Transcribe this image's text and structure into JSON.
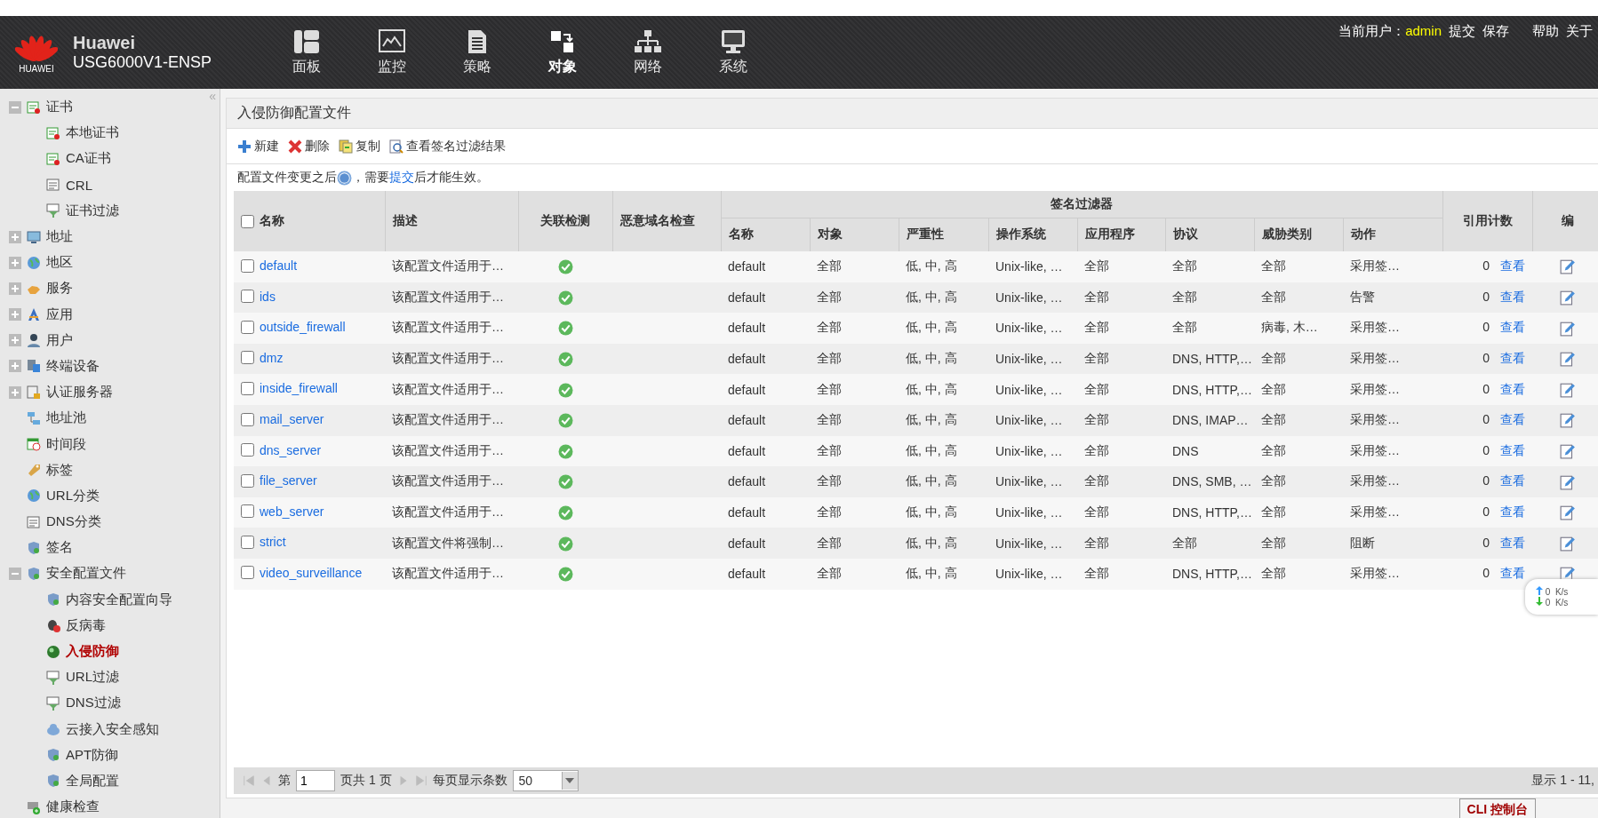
{
  "brand": {
    "name": "Huawei",
    "model": "USG6000V1-ENSP",
    "logo_text": "HUAWEI"
  },
  "nav": [
    {
      "label": "面板",
      "selected": false
    },
    {
      "label": "监控",
      "selected": false
    },
    {
      "label": "策略",
      "selected": false
    },
    {
      "label": "对象",
      "selected": true
    },
    {
      "label": "网络",
      "selected": false
    },
    {
      "label": "系统",
      "selected": false
    }
  ],
  "user_bar": {
    "label": "当前用户：",
    "user": "admin",
    "actions": [
      "提交",
      "保存",
      "帮助",
      "关于"
    ]
  },
  "sidebar": {
    "collapse": "«",
    "items": [
      {
        "label": "证书",
        "expanded": true,
        "selected": false,
        "children": [
          {
            "label": "本地证书",
            "selected": false
          },
          {
            "label": "CA证书",
            "selected": false
          },
          {
            "label": "CRL",
            "selected": false
          },
          {
            "label": "证书过滤",
            "selected": false
          }
        ]
      },
      {
        "label": "地址",
        "expanded": false,
        "selected": false
      },
      {
        "label": "地区",
        "expanded": false,
        "selected": false
      },
      {
        "label": "服务",
        "expanded": false,
        "selected": false
      },
      {
        "label": "应用",
        "expanded": false,
        "selected": false
      },
      {
        "label": "用户",
        "expanded": false,
        "selected": false
      },
      {
        "label": "终端设备",
        "expanded": false,
        "selected": false
      },
      {
        "label": "认证服务器",
        "expanded": false,
        "selected": false
      },
      {
        "label": "地址池",
        "selected": false
      },
      {
        "label": "时间段",
        "selected": false
      },
      {
        "label": "标签",
        "selected": false
      },
      {
        "label": "URL分类",
        "selected": false
      },
      {
        "label": "DNS分类",
        "selected": false
      },
      {
        "label": "签名",
        "selected": false
      },
      {
        "label": "安全配置文件",
        "expanded": true,
        "selected": false,
        "children": [
          {
            "label": "内容安全配置向导",
            "selected": false
          },
          {
            "label": "反病毒",
            "selected": false
          },
          {
            "label": "入侵防御",
            "selected": true
          },
          {
            "label": "URL过滤",
            "selected": false
          },
          {
            "label": "DNS过滤",
            "selected": false
          },
          {
            "label": "云接入安全感知",
            "selected": false
          },
          {
            "label": "APT防御",
            "selected": false
          },
          {
            "label": "全局配置",
            "selected": false
          }
        ]
      },
      {
        "label": "健康检查",
        "selected": false
      }
    ]
  },
  "panel": {
    "title": "入侵防御配置文件",
    "toolbar": [
      "新建",
      "删除",
      "复制",
      "查看签名过滤结果"
    ],
    "note": {
      "before": "配置文件变更之后",
      "middle": "，需要",
      "link": "提交",
      "after": "后才能生效。"
    },
    "table": {
      "select_all_checked": false,
      "columns": {
        "name": "名称",
        "desc": "描述",
        "correlation": "关联检测",
        "domain": "恶意域名检查",
        "filter_group": "签名过滤器",
        "filter": [
          "名称",
          "对象",
          "严重性",
          "操作系统",
          "应用程序",
          "协议",
          "威胁类别",
          "动作"
        ],
        "refs": "引用计数",
        "edit": "编"
      },
      "rows": [
        {
          "checked": false,
          "name": "default",
          "desc": "该配置文件适用于…",
          "correlation": true,
          "filter": [
            "default",
            "全部",
            "低, 中, 高",
            "Unix-like, …",
            "全部",
            "全部",
            "全部",
            "采用签…"
          ],
          "refs": "0",
          "view": "查看"
        },
        {
          "checked": false,
          "name": "ids",
          "desc": "该配置文件适用于…",
          "correlation": true,
          "filter": [
            "default",
            "全部",
            "低, 中, 高",
            "Unix-like, …",
            "全部",
            "全部",
            "全部",
            "告警"
          ],
          "refs": "0",
          "view": "查看"
        },
        {
          "checked": false,
          "name": "outside_firewall",
          "desc": "该配置文件适用于…",
          "correlation": true,
          "filter": [
            "default",
            "全部",
            "低, 中, 高",
            "Unix-like, …",
            "全部",
            "全部",
            "病毒, 木…",
            "采用签…"
          ],
          "refs": "0",
          "view": "查看"
        },
        {
          "checked": false,
          "name": "dmz",
          "desc": "该配置文件适用于…",
          "correlation": true,
          "filter": [
            "default",
            "全部",
            "低, 中, 高",
            "Unix-like, …",
            "全部",
            "DNS, HTTP,…",
            "全部",
            "采用签…"
          ],
          "refs": "0",
          "view": "查看"
        },
        {
          "checked": false,
          "name": "inside_firewall",
          "desc": "该配置文件适用于…",
          "correlation": true,
          "filter": [
            "default",
            "全部",
            "低, 中, 高",
            "Unix-like, …",
            "全部",
            "DNS, HTTP,…",
            "全部",
            "采用签…"
          ],
          "refs": "0",
          "view": "查看"
        },
        {
          "checked": false,
          "name": "mail_server",
          "desc": "该配置文件适用于…",
          "correlation": true,
          "filter": [
            "default",
            "全部",
            "低, 中, 高",
            "Unix-like, …",
            "全部",
            "DNS, IMAP…",
            "全部",
            "采用签…"
          ],
          "refs": "0",
          "view": "查看"
        },
        {
          "checked": false,
          "name": "dns_server",
          "desc": "该配置文件适用于…",
          "correlation": true,
          "filter": [
            "default",
            "全部",
            "低, 中, 高",
            "Unix-like, …",
            "全部",
            "DNS",
            "全部",
            "采用签…"
          ],
          "refs": "0",
          "view": "查看"
        },
        {
          "checked": false,
          "name": "file_server",
          "desc": "该配置文件适用于…",
          "correlation": true,
          "filter": [
            "default",
            "全部",
            "低, 中, 高",
            "Unix-like, …",
            "全部",
            "DNS, SMB, …",
            "全部",
            "采用签…"
          ],
          "refs": "0",
          "view": "查看"
        },
        {
          "checked": false,
          "name": "web_server",
          "desc": "该配置文件适用于…",
          "correlation": true,
          "filter": [
            "default",
            "全部",
            "低, 中, 高",
            "Unix-like, …",
            "全部",
            "DNS, HTTP,…",
            "全部",
            "采用签…"
          ],
          "refs": "0",
          "view": "查看"
        },
        {
          "checked": false,
          "name": "strict",
          "desc": "该配置文件将强制…",
          "correlation": true,
          "filter": [
            "default",
            "全部",
            "低, 中, 高",
            "Unix-like, …",
            "全部",
            "全部",
            "全部",
            "阻断"
          ],
          "refs": "0",
          "view": "查看"
        },
        {
          "checked": false,
          "name": "video_surveillance",
          "desc": "该配置文件适用于…",
          "correlation": true,
          "filter": [
            "default",
            "全部",
            "低, 中, 高",
            "Unix-like, …",
            "全部",
            "DNS, HTTP,…",
            "全部",
            "采用签…"
          ],
          "refs": "0",
          "view": "查看"
        }
      ]
    },
    "pager": {
      "page_label": "第",
      "page": "1",
      "total": "页共 1 页",
      "per_page_label": "每页显示条数",
      "per_page": "50",
      "summary": "显示 1 - 11,"
    }
  },
  "speed_widget": {
    "up": "0",
    "up_unit": "K/s",
    "down": "0",
    "down_unit": "K/s"
  },
  "cli_button": "CLI 控制台"
}
